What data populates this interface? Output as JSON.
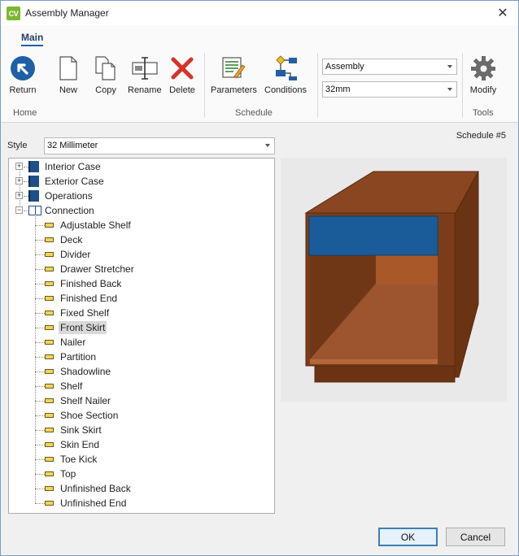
{
  "window": {
    "title": "Assembly Manager",
    "app_badge": "CV"
  },
  "ribbon": {
    "tab": "Main",
    "buttons": {
      "return": "Return",
      "new": "New",
      "copy": "Copy",
      "rename": "Rename",
      "delete": "Delete",
      "parameters": "Parameters",
      "conditions": "Conditions",
      "modify": "Modify"
    },
    "groups": {
      "home": "Home",
      "schedule": "Schedule",
      "tools": "Tools"
    },
    "combos": {
      "type_value": "Assembly",
      "size_value": "32mm"
    }
  },
  "style": {
    "label": "Style",
    "value": "32 Millimeter"
  },
  "schedule_label": "Schedule #5",
  "tree": {
    "roots": [
      "Interior Case",
      "Exterior Case",
      "Operations",
      "Connection"
    ],
    "connection_items": [
      "Adjustable Shelf",
      "Deck",
      "Divider",
      "Drawer Stretcher",
      "Finished Back",
      "Finished End",
      "Fixed Shelf",
      "Front Skirt",
      "Nailer",
      "Partition",
      "Shadowline",
      "Shelf",
      "Shelf Nailer",
      "Shoe Section",
      "Sink Skirt",
      "Skin End",
      "Toe Kick",
      "Top",
      "Unfinished Back",
      "Unfinished End"
    ],
    "selected": "Front Skirt"
  },
  "footer": {
    "ok": "OK",
    "cancel": "Cancel"
  },
  "colors": {
    "accent": "#1e5fa8",
    "cabinet": "#7b3d19",
    "drawer_front": "#1a5c99",
    "badge": "#7cb82f"
  }
}
